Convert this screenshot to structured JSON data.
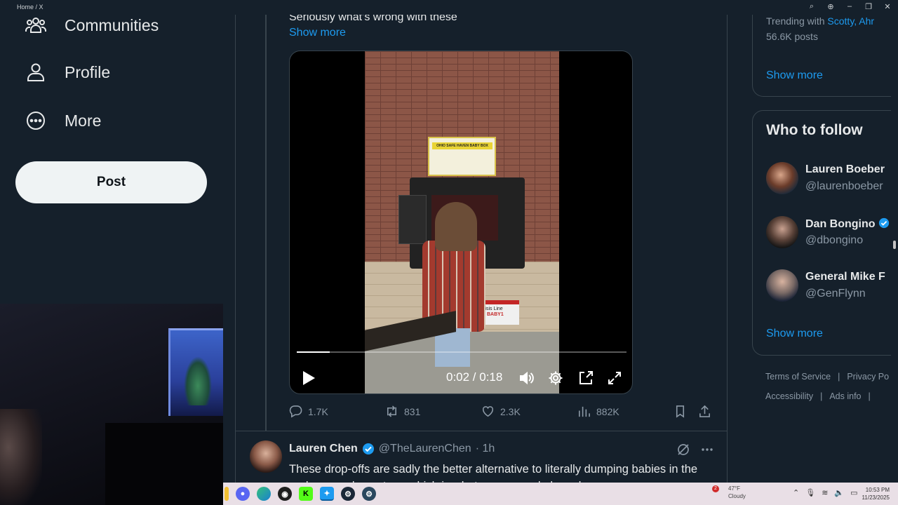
{
  "window": {
    "tab_title": "Home / X",
    "controls": [
      "search-icon",
      "zoom-icon",
      "minimize-icon",
      "restore-icon",
      "close-icon"
    ]
  },
  "sidebar": {
    "items": [
      {
        "label": "Communities",
        "icon": "communities-icon"
      },
      {
        "label": "Profile",
        "icon": "profile-icon"
      },
      {
        "label": "More",
        "icon": "more-icon"
      }
    ],
    "post_label": "Post"
  },
  "tweet1": {
    "text": "Seriously what’s wrong with these",
    "show_more": "Show more",
    "video": {
      "time": "0:02 / 0:18",
      "progress": 0.1,
      "sign_text": "OHIO SAFE HAVEN BABY BOX",
      "floor_sign_text": "Crisis Line",
      "floor_sign_sub": "BABY1"
    },
    "actions": {
      "replies": "1.7K",
      "reposts": "831",
      "likes": "2.3K",
      "views": "882K"
    }
  },
  "tweet2": {
    "name": "Lauren Chen",
    "handle": "@TheLaurenChen",
    "time": "· 1h",
    "text": "These drop-offs are sadly the better alternative to literally dumping babies in the garbage or dumpsters, which is what some people have been"
  },
  "trending": {
    "with_prefix": "Trending with",
    "with_names": "Scotty, Ahr",
    "posts": "56.6K posts",
    "show_more": "Show more"
  },
  "who_to_follow": {
    "title": "Who to follow",
    "accounts": [
      {
        "name": "Lauren Boeber",
        "handle": "@laurenboeber"
      },
      {
        "name": "Dan Bongino",
        "handle": "@dbongino"
      },
      {
        "name": "General Mike F",
        "handle": "@GenFlynn"
      }
    ],
    "show_more": "Show more"
  },
  "footer": {
    "links": [
      "Terms of Service",
      "Privacy Po",
      "Accessibility",
      "Ads info"
    ]
  },
  "taskbar": {
    "apps": [
      "explorer",
      "discord",
      "edge",
      "obs",
      "kick",
      "twitter",
      "steam",
      "steam2"
    ],
    "weather_temp": "47°F",
    "weather_desc": "Cloudy",
    "notification_count": "2",
    "time": "10:53 PM",
    "date": "11/23/2025"
  }
}
